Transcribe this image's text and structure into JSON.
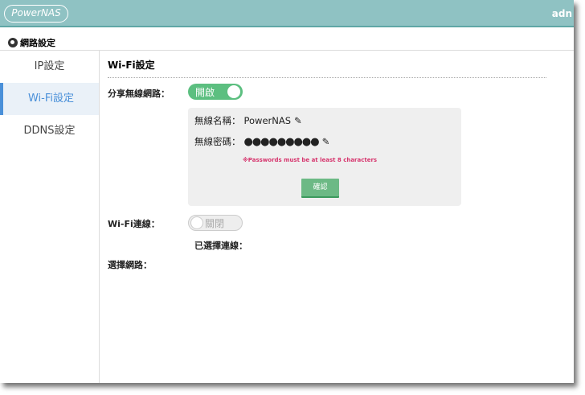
{
  "header": {
    "logo": "PowerNAS",
    "user": "adn"
  },
  "subheader": {
    "title": "網路設定"
  },
  "sidebar": {
    "items": [
      {
        "label": "IP設定"
      },
      {
        "label": "Wi-Fi設定",
        "active": true
      },
      {
        "label": "DDNS設定"
      }
    ]
  },
  "main": {
    "title": "Wi-Fi設定",
    "share_label": "分享無線網路：",
    "share_toggle": "開啟",
    "share_on": true,
    "ssid_label": "無線名稱：",
    "ssid_value": "PowerNAS",
    "pwd_label": "無線密碼：",
    "pwd_value": "●●●●●●●●●",
    "error": "※Passwords must be at least 8 characters",
    "confirm": "確認",
    "wifi_label": "Wi-Fi連線：",
    "wifi_toggle": "關閉",
    "wifi_on": false,
    "selected_label": "已選擇連線：",
    "choose_label": "選擇網路："
  },
  "colors": {
    "header": "#8fc2c3",
    "accent": "#4a90d9",
    "toggle_on": "#5cbf80",
    "error": "#d6336c"
  }
}
